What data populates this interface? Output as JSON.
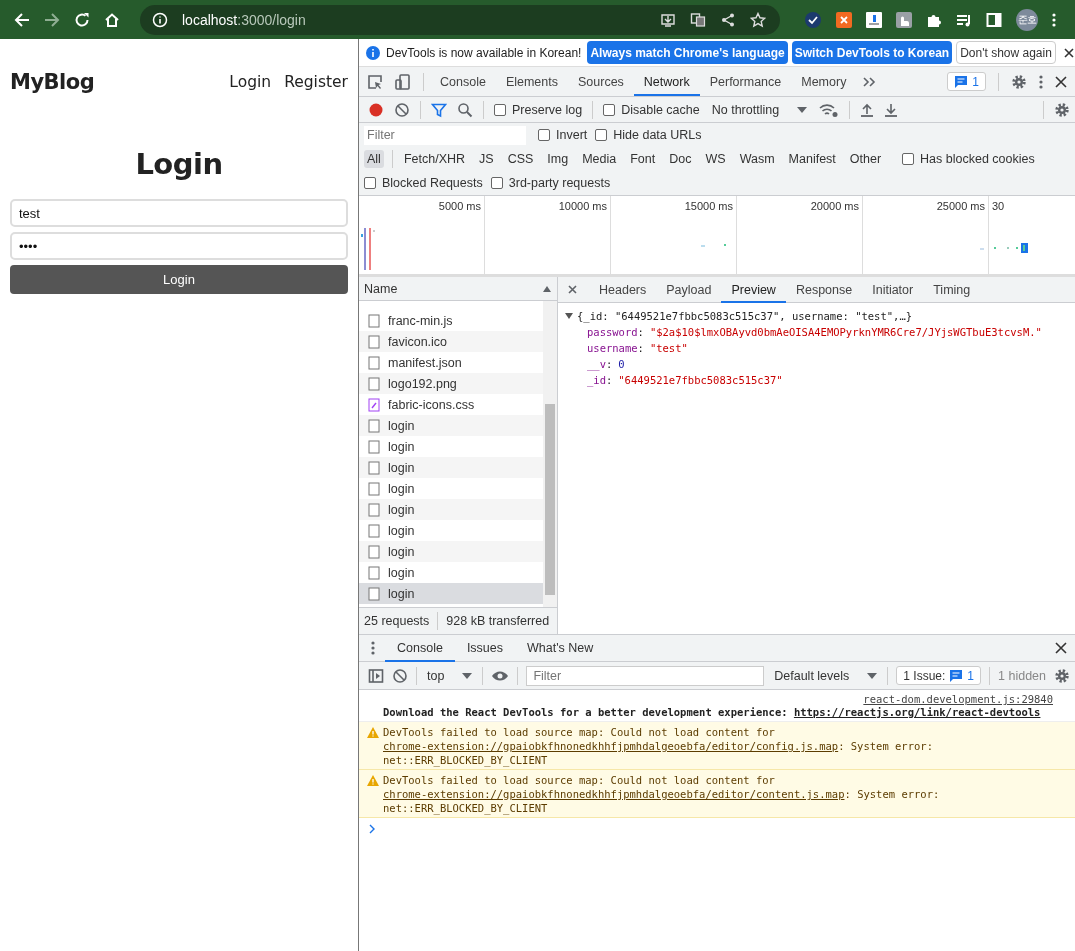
{
  "browser": {
    "url": {
      "host": "localhost",
      "path": ":3000/login"
    },
    "forward_disabled": true,
    "avatar": "준호"
  },
  "page": {
    "brand": "MyBlog",
    "nav": [
      "Login",
      "Register"
    ],
    "heading": "Login",
    "fields": [
      {
        "value": "test"
      },
      {
        "value": "••••"
      }
    ],
    "submit": "Login"
  },
  "devtools": {
    "infobar": {
      "message": "DevTools is now available in Korean!",
      "buttons": [
        {
          "label": "Always match Chrome's language",
          "kind": "primary"
        },
        {
          "label": "Switch DevTools to Korean",
          "kind": "primary"
        },
        {
          "label": "Don't show again",
          "kind": "plain"
        }
      ]
    },
    "tabs": [
      {
        "label": "Console",
        "selected": false
      },
      {
        "label": "Elements",
        "selected": false
      },
      {
        "label": "Sources",
        "selected": false
      },
      {
        "label": "Network",
        "selected": true
      },
      {
        "label": "Performance",
        "selected": false
      },
      {
        "label": "Memory",
        "selected": false
      }
    ],
    "issues_count": "1",
    "network_toolbar": {
      "preserve_log": {
        "label": "Preserve log",
        "checked": false
      },
      "disable_cache": {
        "label": "Disable cache",
        "checked": false
      },
      "throttling": "No throttling"
    },
    "filter": {
      "placeholder": "Filter",
      "options": [
        {
          "label": "Invert",
          "checked": false
        },
        {
          "label": "Hide data URLs",
          "checked": false
        }
      ]
    },
    "types": [
      {
        "label": "All",
        "selected": true
      },
      {
        "label": "Fetch/XHR",
        "selected": false
      },
      {
        "label": "JS",
        "selected": false
      },
      {
        "label": "CSS",
        "selected": false
      },
      {
        "label": "Img",
        "selected": false
      },
      {
        "label": "Media",
        "selected": false
      },
      {
        "label": "Font",
        "selected": false
      },
      {
        "label": "Doc",
        "selected": false
      },
      {
        "label": "WS",
        "selected": false
      },
      {
        "label": "Wasm",
        "selected": false
      },
      {
        "label": "Manifest",
        "selected": false
      },
      {
        "label": "Other",
        "selected": false
      }
    ],
    "has_blocked_cookies": {
      "label": "Has blocked cookies",
      "checked": false
    },
    "more_filters": [
      {
        "label": "Blocked Requests",
        "checked": false
      },
      {
        "label": "3rd-party requests",
        "checked": false
      }
    ],
    "timeline_ticks": [
      "5000 ms",
      "10000 ms",
      "15000 ms",
      "20000 ms",
      "25000 ms",
      "30"
    ],
    "requests": {
      "column": "Name",
      "rows": [
        {
          "name": "franc-min.js",
          "kind": "doc",
          "selected": false
        },
        {
          "name": "favicon.ico",
          "kind": "doc",
          "selected": false
        },
        {
          "name": "manifest.json",
          "kind": "doc",
          "selected": false
        },
        {
          "name": "logo192.png",
          "kind": "doc",
          "selected": false
        },
        {
          "name": "fabric-icons.css",
          "kind": "css",
          "selected": false
        },
        {
          "name": "login",
          "kind": "doc",
          "selected": false
        },
        {
          "name": "login",
          "kind": "doc",
          "selected": false
        },
        {
          "name": "login",
          "kind": "doc",
          "selected": false
        },
        {
          "name": "login",
          "kind": "doc",
          "selected": false
        },
        {
          "name": "login",
          "kind": "doc",
          "selected": false
        },
        {
          "name": "login",
          "kind": "doc",
          "selected": false
        },
        {
          "name": "login",
          "kind": "doc",
          "selected": false
        },
        {
          "name": "login",
          "kind": "doc",
          "selected": false
        },
        {
          "name": "login",
          "kind": "doc",
          "selected": true
        }
      ],
      "summary": [
        "25 requests",
        "928 kB transferred"
      ]
    },
    "detail_tabs": [
      {
        "label": "Headers",
        "selected": false
      },
      {
        "label": "Payload",
        "selected": false
      },
      {
        "label": "Preview",
        "selected": true
      },
      {
        "label": "Response",
        "selected": false
      },
      {
        "label": "Initiator",
        "selected": false
      },
      {
        "label": "Timing",
        "selected": false
      }
    ],
    "preview": {
      "separator": ":",
      "summary": "{_id: \"6449521e7fbbc5083c515c37\", username: \"test\",…}",
      "expanded": true,
      "props": [
        {
          "key": "password",
          "value": "\"$2a$10$lmxOBAyvd0bmAeOISA4EMOPyrknYMR6Cre7/JYjsWGTbuE3tcvsM.\"",
          "kind": "string"
        },
        {
          "key": "username",
          "value": "\"test\"",
          "kind": "string"
        },
        {
          "key": "__v",
          "value": "0",
          "kind": "number"
        },
        {
          "key": "_id",
          "value": "\"6449521e7fbbc5083c515c37\"",
          "kind": "string"
        }
      ]
    },
    "drawer": {
      "tabs": [
        {
          "label": "Console",
          "selected": true
        },
        {
          "label": "Issues",
          "selected": false
        },
        {
          "label": "What's New",
          "selected": false
        }
      ],
      "context": "top",
      "filter_placeholder": "Filter",
      "levels": "Default levels",
      "issues_label": "1 Issue:",
      "issues_count": "1",
      "hidden": "1 hidden",
      "messages": [
        {
          "kind": "info",
          "source": "react-dom.development.js:29840",
          "segments": [
            {
              "text": "Download the React DevTools for a better development experience: ",
              "kind": "text"
            },
            {
              "text": "https://reactjs.org/link/react-devtools",
              "kind": "link"
            }
          ]
        },
        {
          "kind": "warning",
          "segments": [
            {
              "text": "DevTools failed to load source map: Could not load content for ",
              "kind": "text"
            },
            {
              "text": "chrome-extension://gpaiobkfhnonedkhhfjpmhdalgeoebfa/editor/config.js.map",
              "kind": "link"
            },
            {
              "text": ": System error: net::ERR_BLOCKED_BY_CLIENT",
              "kind": "text"
            }
          ]
        },
        {
          "kind": "warning",
          "segments": [
            {
              "text": "DevTools failed to load source map: Could not load content for ",
              "kind": "text"
            },
            {
              "text": "chrome-extension://gpaiobkfhnonedkhhfjpmhdalgeoebfa/editor/content.js.map",
              "kind": "link"
            },
            {
              "text": ": System error: net::ERR_BLOCKED_BY_CLIENT",
              "kind": "text"
            }
          ]
        }
      ]
    }
  }
}
